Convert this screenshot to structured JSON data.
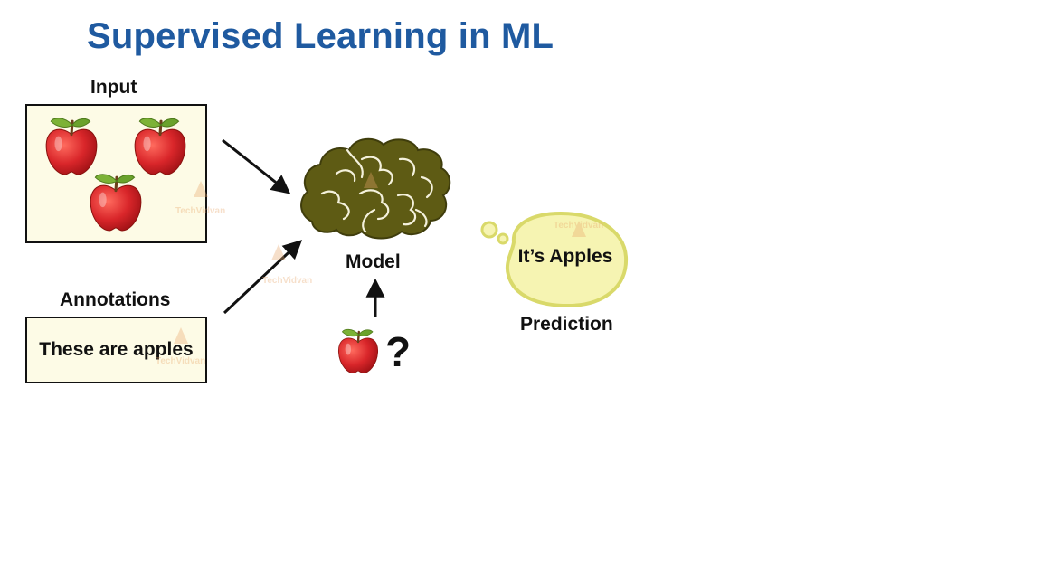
{
  "slide": {
    "title": "Supervised Learning in ML",
    "input_label": "Input",
    "annotations_label": "Annotations",
    "annotation_text": "These are apples",
    "model_label": "Model",
    "prediction_bubble_text": "It’s Apples",
    "prediction_label": "Prediction",
    "query_symbol": "?",
    "watermark_text": "TechVidvan"
  },
  "colors": {
    "title": "#1f5aa0",
    "box_fill": "#fdfbe6",
    "brain": "#5e5b14",
    "apple": "#d9262a",
    "leaf": "#6aa22c",
    "bubble_fill": "#f6f4b2",
    "bubble_stroke": "#d9d96a"
  },
  "icons": {
    "input_items": [
      "apple-icon",
      "apple-icon",
      "apple-icon"
    ],
    "model": "brain-icon",
    "query": "apple-icon"
  }
}
